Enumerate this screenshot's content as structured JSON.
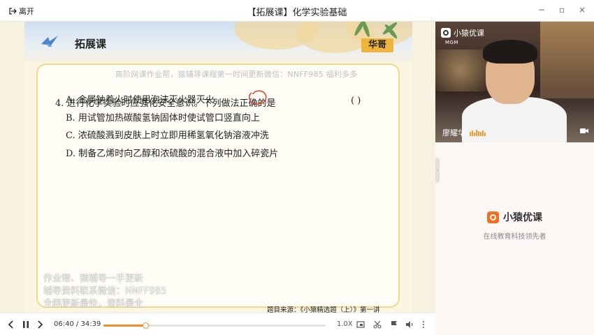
{
  "window": {
    "leave_label": "离开",
    "title": "【拓展课】化学实验基础",
    "minimize": "−",
    "restore": "▫",
    "close": "×"
  },
  "slide": {
    "course_label": "拓展课",
    "teacher_tag": "华哥",
    "watermark_top": "高阶网课作业帮，猿辅导课程第一时间更新微信：NNFF985 福利多多",
    "question": "4. 进行化学实验时应强化安全意识。下列做法正确的是",
    "answer_paren": "(      )",
    "options": [
      "A. 金属钠着火时使用泡沫灭火器灭火",
      "B. 用试管加热碳酸氢钠固体时使试管口竖直向上",
      "C. 浓硫酸溅到皮肤上时立即用稀氢氧化钠溶液冲洗",
      "D. 制备乙烯时向乙醇和浓硫酸的混合液中加入碎瓷片"
    ],
    "watermark_left": [
      "作业帮、猿辅导一手更新",
      "辅导资料联系微信：NNFF985",
      "全网更新最快，资料最全"
    ],
    "source": "题目来源：《小猿精选题（上）》第一讲"
  },
  "video": {
    "logo_text": "小猿优课",
    "mgm": "MGM",
    "teacher_name": "廖耀华"
  },
  "brand": {
    "name": "小猿优课",
    "slogan": "在线教育科技领先者"
  },
  "player": {
    "current_time": "06:40",
    "total_time": "34:39",
    "time_display": "06:40 / 34:39",
    "progress_fraction": 0.19,
    "speed": "1.0X"
  },
  "colors": {
    "accent": "#f58a2a",
    "brand_orange": "#f36d1f",
    "slide_border": "#f3d88a",
    "teacher_tag": "#f0b43b"
  }
}
